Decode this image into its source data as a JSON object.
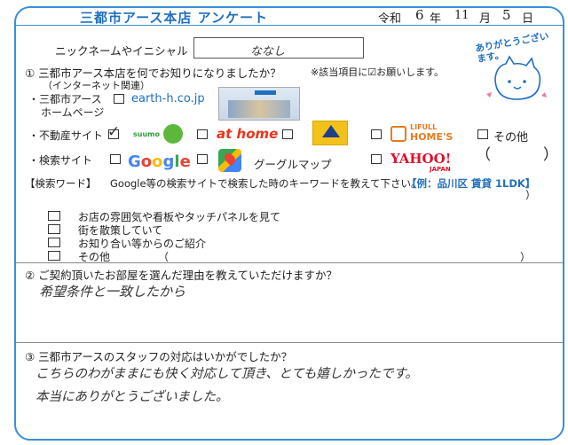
{
  "header": {
    "title": "三都市アース本店 アンケート",
    "era": "令和",
    "year": "6",
    "year_unit": "年",
    "month": "11",
    "month_unit": "月",
    "day": "5",
    "day_unit": "日"
  },
  "nickname": {
    "label": "ニックネームやイニシャル",
    "value": "ななし"
  },
  "sticker": {
    "text": "ありがとうございます。"
  },
  "q1": {
    "question": "① 三都市アース本店を何でお知りになりましたか？",
    "note": "※該当項目に☑お願いします。",
    "sub": "（インターネット関連）",
    "homepage_label1": "・三都市アース",
    "homepage_label2": "ホームページ",
    "homepage_url": "earth-h.co.jp",
    "realestate_label": "・不動産サイト",
    "suumo": "suumo",
    "athome": "at home",
    "homes_top": "LIFULL",
    "homes": "HOME'S",
    "other": "その他",
    "paren_open": "（",
    "paren_close": "）",
    "search_label": "・検索サイト",
    "google": "Google",
    "googlemap": "グーグルマップ",
    "yahoo": "YAHOO!",
    "yahoo_sub": "JAPAN",
    "keyword_label": "【検索ワード】",
    "keyword_desc": "Google等の検索サイトで検索した時のキーワードを教えて下さい。",
    "keyword_example": "【例：品川区 賃貸 1LDK】",
    "keyword_paren": "）",
    "offline_items": [
      "お店の雰囲気や看板やタッチパネルを見て",
      "街を散策していて",
      "お知り合い等からのご紹介",
      "その他"
    ],
    "offline_other_open": "（",
    "offline_other_close": "）"
  },
  "q2": {
    "question": "② ご契約頂いたお部屋を選んだ理由を教えていただけますか？",
    "answer": "希望条件と一致したから"
  },
  "q3": {
    "question": "③ 三都市アースのスタッフの対応はいかがでしたか？",
    "answer_line1": "こちらのわがままにも快く対応して頂き、とても嬉しかったです。",
    "answer_line2": "本当にありがとうございました。"
  },
  "checked": {
    "suumo": true
  },
  "colors": {
    "brand_blue": "#1f6fbf",
    "frame_blue": "#3a8fd6"
  }
}
